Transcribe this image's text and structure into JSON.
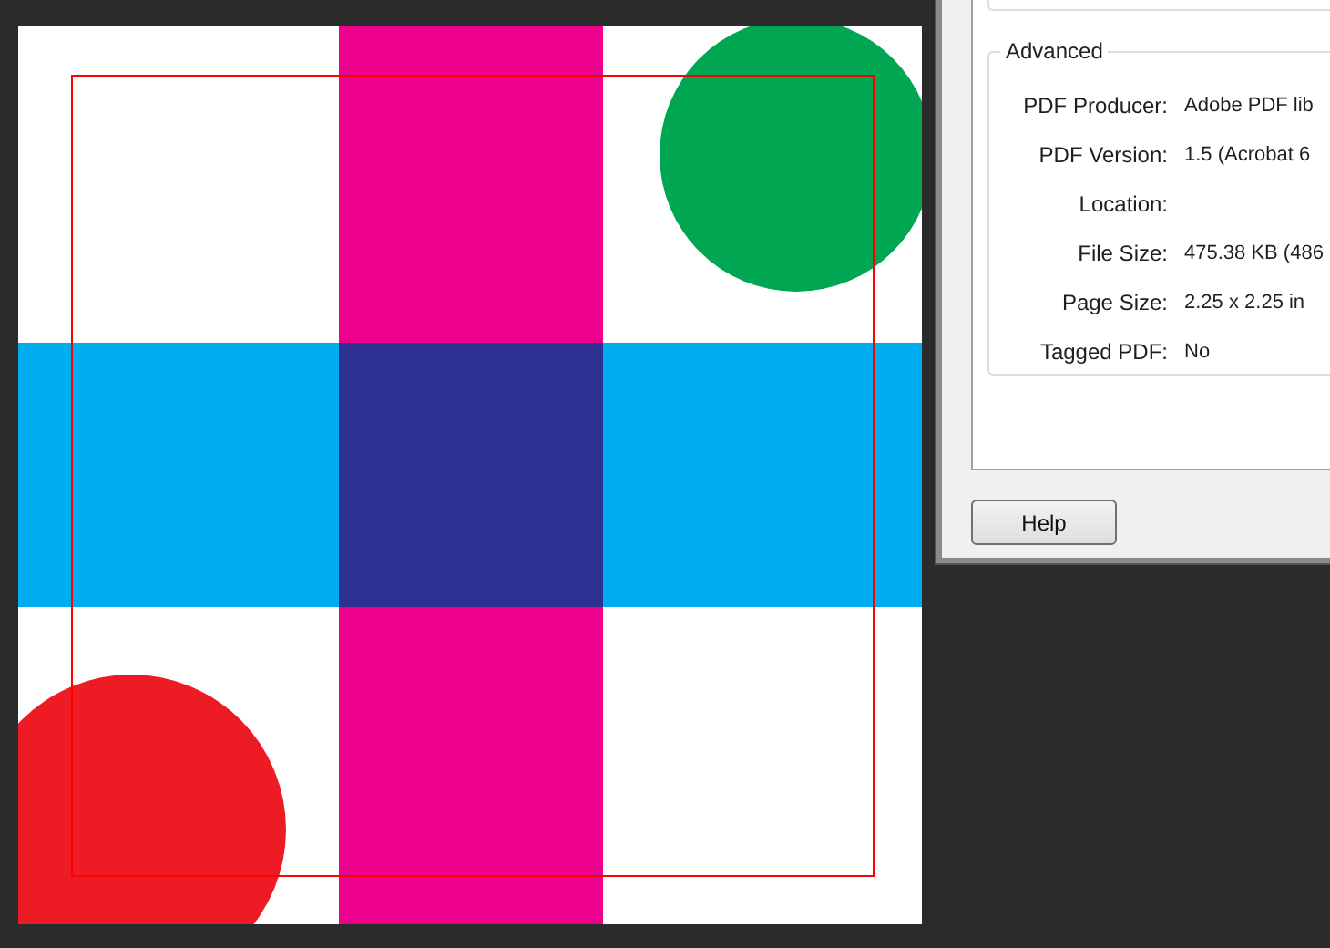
{
  "dialog": {
    "group_title": "Advanced",
    "fields": [
      {
        "label": "PDF Producer:",
        "value": "Adobe PDF lib"
      },
      {
        "label": "PDF Version:",
        "value": "1.5 (Acrobat 6"
      },
      {
        "label": "Location:"
      },
      {
        "label": "File Size:",
        "value": "475.38 KB (486"
      },
      {
        "label": "Page Size:",
        "value": "2.25 x 2.25 in"
      },
      {
        "label": "Tagged PDF:",
        "value": "No"
      }
    ],
    "buttons": [
      "Help"
    ]
  }
}
